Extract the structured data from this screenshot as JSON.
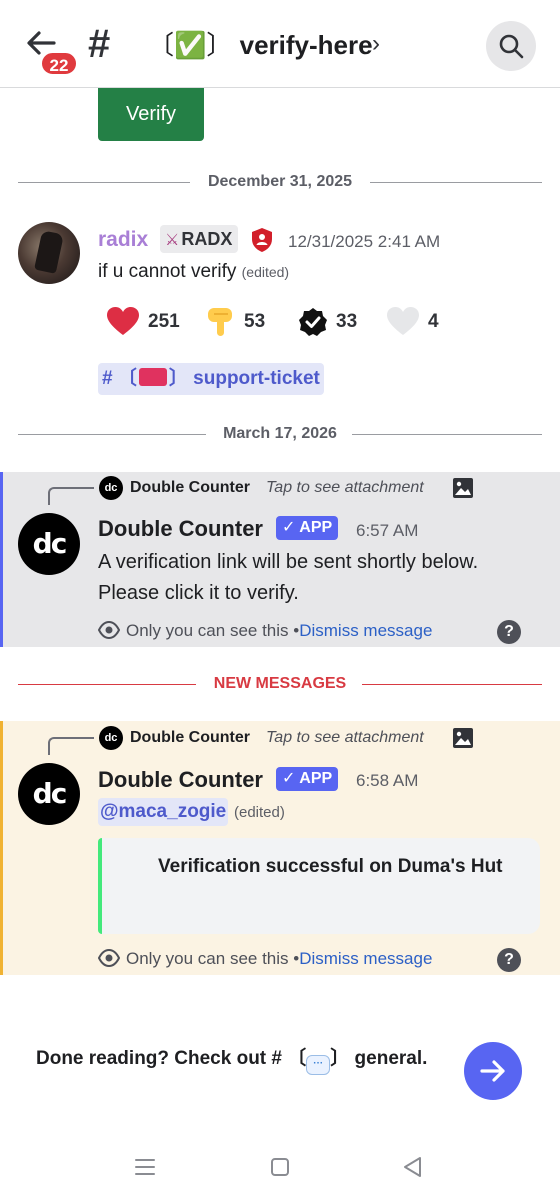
{
  "header": {
    "unread_count": "22",
    "hash": "#",
    "channel_prefix": "〔✅〕",
    "channel_name": "verify-here",
    "chevron": "›",
    "icons": [
      "back-arrow-icon",
      "hash-icon",
      "search-icon"
    ]
  },
  "verify_button": {
    "label": "Verify"
  },
  "dividers": {
    "date1": "December 31, 2025",
    "date2": "March 17, 2026",
    "new_messages": "NEW MESSAGES"
  },
  "radix_message": {
    "username": "radix",
    "tag": "RADX",
    "timestamp": "12/31/2025 2:41 AM",
    "text": "if u cannot verify",
    "edited": "(edited)",
    "reactions": [
      {
        "emoji": "heart",
        "count": "251"
      },
      {
        "emoji": "point-down",
        "count": "53"
      },
      {
        "emoji": "verified-check",
        "count": "33"
      },
      {
        "emoji": "white-heart",
        "count": "4"
      }
    ],
    "channel_link": "support-ticket",
    "channel_link_hash": "#",
    "channel_link_prefix": "〔",
    "channel_link_suffix": "〕"
  },
  "ephemeral_1": {
    "reply_name": "Double Counter",
    "reply_tap": "Tap to see attachment",
    "author": "Double Counter",
    "app_tag": "✓ APP",
    "timestamp": "6:57 AM",
    "line1": "A verification link will be sent shortly below.",
    "line2": "Please click it to verify.",
    "only_you": "Only you can see this",
    "bullet": "•",
    "dismiss": "Dismiss message"
  },
  "ephemeral_2": {
    "reply_name": "Double Counter",
    "reply_tap": "Tap to see attachment",
    "author": "Double Counter",
    "app_tag": "✓ APP",
    "timestamp": "6:58 AM",
    "mention": "@maca_zogie",
    "edited": "(edited)",
    "embed_title": "Verification successful on Duma's Hut",
    "only_you": "Only you can see this",
    "bullet": "•",
    "dismiss": "Dismiss message"
  },
  "footer": {
    "done_prefix": "Done reading? Check out # 〔",
    "done_suffix": "〕 general.",
    "bubble": "···"
  },
  "colors": {
    "blurple": "#5865f2",
    "verify_green": "#248046",
    "new_messages_red": "#d83a42",
    "radix_name": "#a97fd6"
  }
}
